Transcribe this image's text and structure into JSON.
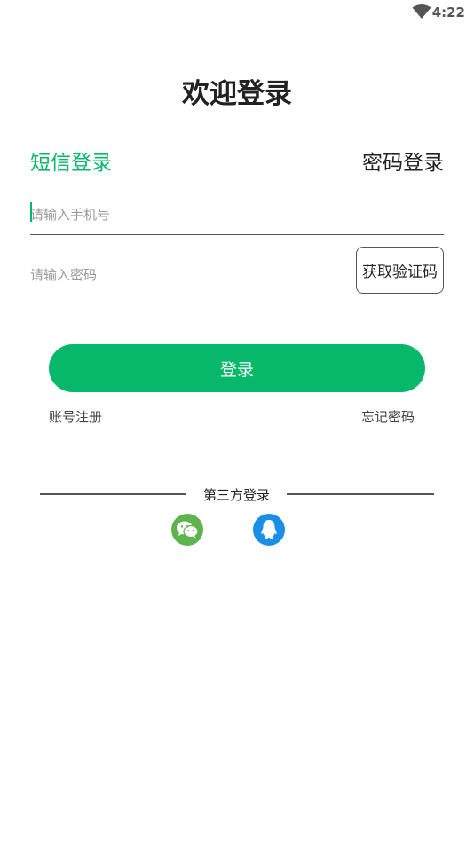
{
  "status_bar": {
    "time": "4:22",
    "icons": [
      "wifi-icon"
    ]
  },
  "page_title": "欢迎登录",
  "tabs": {
    "sms": "短信登录",
    "password": "密码登录",
    "active": "sms"
  },
  "phone": {
    "placeholder": "请输入手机号",
    "value": ""
  },
  "code": {
    "placeholder": "请输入密码",
    "value": ""
  },
  "get_code_label": "获取验证码",
  "login_label": "登录",
  "links": {
    "register": "账号注册",
    "forgot": "忘记密码"
  },
  "third_party": {
    "title": "第三方登录",
    "providers": [
      {
        "icon": "wechat-icon",
        "color": "#5fb34d"
      },
      {
        "icon": "qq-icon",
        "color": "#1a8fe8"
      }
    ]
  },
  "colors": {
    "accent": "#07b86a",
    "text": "#222222",
    "placeholder": "#9a9a9a"
  }
}
